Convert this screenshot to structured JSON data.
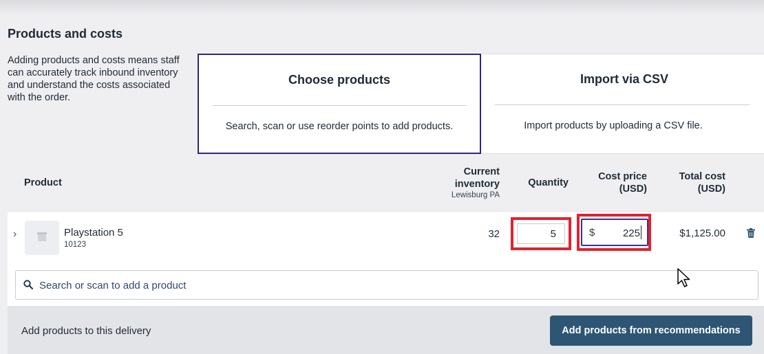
{
  "section": {
    "title": "Products and costs",
    "description": "Adding products and costs means staff can accurately track inbound inventory and understand the costs associated with the order."
  },
  "options": [
    {
      "title": "Choose products",
      "description": "Search, scan or use reorder points to add products.",
      "selected": true
    },
    {
      "title": "Import via CSV",
      "description": "Import products by uploading a CSV file.",
      "selected": false
    }
  ],
  "table": {
    "headers": {
      "product": "Product",
      "inventory": "Current inventory",
      "inventory_location": "Lewisburg PA",
      "quantity": "Quantity",
      "cost_price": "Cost price (USD)",
      "total_cost": "Total cost (USD)"
    },
    "rows": [
      {
        "name": "Playstation 5",
        "sku": "10123",
        "inventory": "32",
        "quantity": "5",
        "currency_symbol": "$",
        "cost_price": "225",
        "total_cost": "$1,125.00"
      }
    ]
  },
  "search": {
    "placeholder": "Search or scan to add a product",
    "value": ""
  },
  "footer": {
    "text": "Add products to this delivery",
    "button_label": "Add products from recommendations"
  },
  "colors": {
    "accent": "#2d2585",
    "highlight": "#e0232e",
    "button": "#2e5573",
    "search_text": "#2f4a6d"
  }
}
